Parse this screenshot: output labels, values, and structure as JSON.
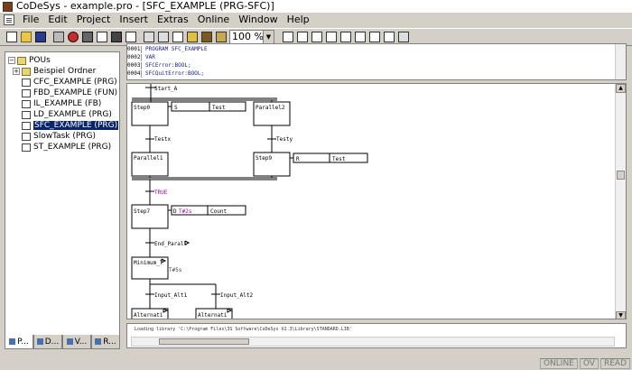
{
  "window": {
    "title": "CoDeSys - example.pro - [SFC_EXAMPLE (PRG-SFC)]"
  },
  "menu": [
    "File",
    "Edit",
    "Project",
    "Insert",
    "Extras",
    "Online",
    "Window",
    "Help"
  ],
  "toolbar": {
    "zoom_value": "100 %",
    "icons": [
      "new-icon",
      "open-icon",
      "save-icon",
      "print-icon",
      "build-icon",
      "login-icon",
      "logout-icon",
      "run-icon",
      "stop-icon",
      "step-icon",
      "breakpoint-icon",
      "find-icon",
      "replace-icon",
      "cut-icon",
      "copy-icon",
      "paste-icon",
      "step-transition-icon",
      "alternative-branch-icon",
      "parallel-branch-icon",
      "jump-icon",
      "label-icon",
      "macro-icon",
      "action-icon",
      "help-icon"
    ]
  },
  "pou_tree": {
    "root": "POUs",
    "folder": "Beispiel Ordner",
    "items": [
      {
        "label": "CFC_EXAMPLE (PRG)"
      },
      {
        "label": "FBD_EXAMPLE (FUN)"
      },
      {
        "label": "IL_EXAMPLE (FB)"
      },
      {
        "label": "LD_EXAMPLE (PRG)"
      },
      {
        "label": "SFC_EXAMPLE (PRG)"
      },
      {
        "label": "SlowTask (PRG)"
      },
      {
        "label": "ST_EXAMPLE (PRG)"
      }
    ],
    "selected_index": 4
  },
  "left_tabs": [
    "P...",
    "D...",
    "V...",
    "R..."
  ],
  "declaration": {
    "lines": [
      {
        "num": "0001",
        "text": "PROGRAM SFC_EXAMPLE"
      },
      {
        "num": "0002",
        "text": "VAR"
      },
      {
        "num": "0003",
        "text": "    SFCError:BOOL;"
      },
      {
        "num": "0004",
        "text": "    SFCQuitError:BOOL;"
      }
    ]
  },
  "sfc": {
    "top_transition": "Start_A",
    "step0": "Step0",
    "step0_action_qualifier": "S",
    "step0_action": "Test",
    "parallel2": "Parallel2",
    "testx": "Testx",
    "testy": "Testy",
    "parallel1": "Parallel1",
    "step9": "Step9",
    "step9_action_qualifier": "R",
    "step9_action": "Test",
    "true_transition": "TRUE",
    "step7": "Step7",
    "step7_action_qualifier": "D",
    "step7_action_time": "T#2s",
    "step7_action": "Count",
    "end_parall": "End_Parall",
    "minimum_step": "Minimum_T",
    "minimum_time": "T#5s",
    "input_alt1": "Input_Alt1",
    "input_alt2": "Input_Alt2",
    "alternative1": "Alternati",
    "alternative2": "Alternati"
  },
  "message": {
    "text": "Loading library 'C:\\Program Files\\3S Software\\CoDeSys V2.3\\Library\\STANDARD.LIB'"
  },
  "status": [
    "ONLINE",
    "OV",
    "READ"
  ]
}
